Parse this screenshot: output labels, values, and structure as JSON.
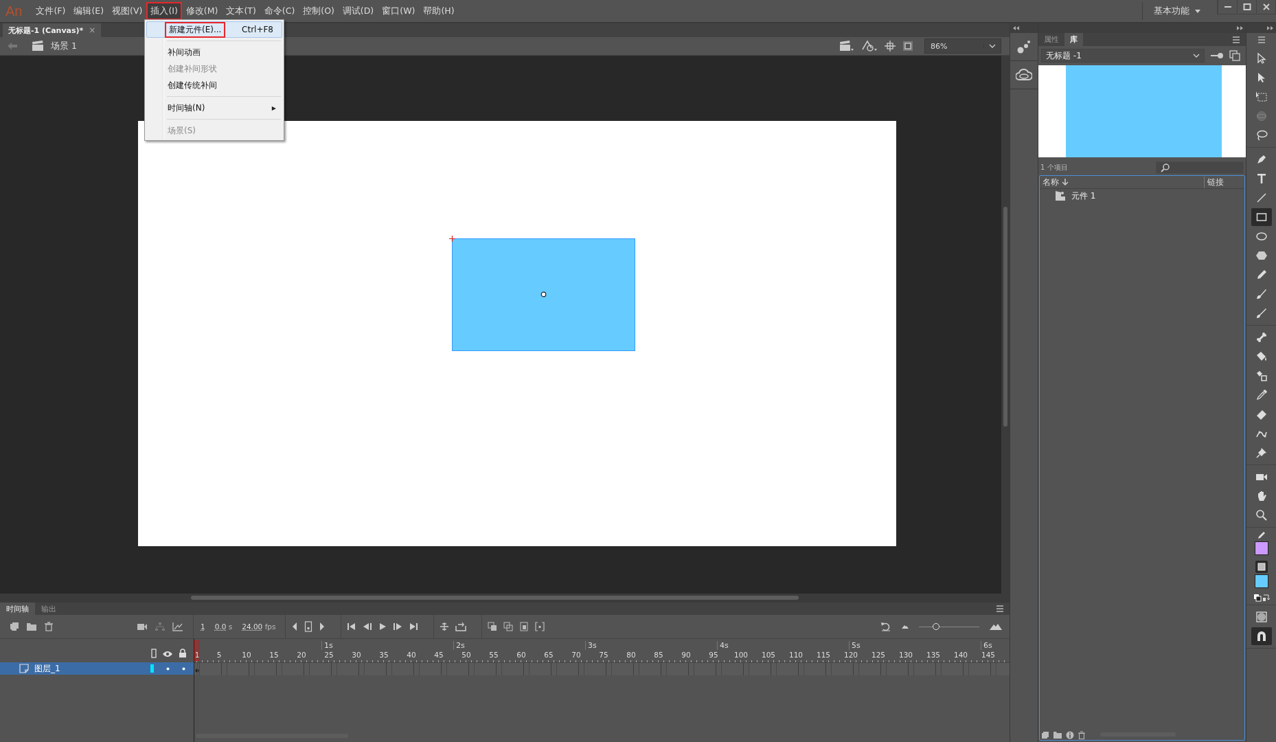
{
  "app": {
    "logo": "An"
  },
  "menu_bar": [
    {
      "label": "文件(F)",
      "selected": false,
      "highlighted": false
    },
    {
      "label": "编辑(E)",
      "selected": false,
      "highlighted": false
    },
    {
      "label": "视图(V)",
      "selected": false,
      "highlighted": false
    },
    {
      "label": "插入(I)",
      "selected": true,
      "highlighted": true
    },
    {
      "label": "修改(M)",
      "selected": false,
      "highlighted": false
    },
    {
      "label": "文本(T)",
      "selected": false,
      "highlighted": false
    },
    {
      "label": "命令(C)",
      "selected": false,
      "highlighted": false
    },
    {
      "label": "控制(O)",
      "selected": false,
      "highlighted": false
    },
    {
      "label": "调试(D)",
      "selected": false,
      "highlighted": false
    },
    {
      "label": "窗口(W)",
      "selected": false,
      "highlighted": false
    },
    {
      "label": "帮助(H)",
      "selected": false,
      "highlighted": false
    }
  ],
  "workspace": {
    "label": "基本功能"
  },
  "document_tabs": [
    {
      "title": "无标题-1 (Canvas)*",
      "close": "×",
      "selected": true
    }
  ],
  "edit_bar": {
    "scene": "场景 1",
    "zoom": "86%"
  },
  "insert_menu": {
    "items": [
      {
        "kind": "item",
        "label": "新建元件(E)...",
        "shortcut": "Ctrl+F8",
        "selected": true,
        "disabled": false,
        "highlighted": true
      },
      {
        "kind": "separator"
      },
      {
        "kind": "item",
        "label": "补间动画",
        "selected": false,
        "disabled": false,
        "highlighted": false
      },
      {
        "kind": "item",
        "label": "创建补间形状",
        "selected": false,
        "disabled": true,
        "highlighted": false
      },
      {
        "kind": "item",
        "label": "创建传统补间",
        "selected": false,
        "disabled": false,
        "highlighted": false
      },
      {
        "kind": "separator"
      },
      {
        "kind": "submenu",
        "label": "时间轴(N)",
        "arrow": "▶",
        "selected": false,
        "disabled": false,
        "highlighted": false
      },
      {
        "kind": "separator"
      },
      {
        "kind": "item",
        "label": "场景(S)",
        "selected": false,
        "disabled": true,
        "highlighted": false
      }
    ]
  },
  "timeline": {
    "tabs": [
      {
        "label": "时间轴",
        "selected": true
      },
      {
        "label": "输出",
        "selected": false
      }
    ],
    "frame": "1",
    "time": "0.0",
    "time_unit": "s",
    "fps": "24.00",
    "fps_unit": "fps",
    "seconds": [
      "1s",
      "2s",
      "3s",
      "4s",
      "5s",
      "6s"
    ],
    "frame_numbers": [
      "1",
      "5",
      "10",
      "15",
      "20",
      "25",
      "30",
      "35",
      "40",
      "45",
      "50",
      "55",
      "60",
      "65",
      "70",
      "75",
      "80",
      "85",
      "90",
      "95",
      "100",
      "105",
      "110",
      "115",
      "120",
      "125",
      "130",
      "135",
      "140",
      "145"
    ],
    "frame_size": {
      "level": 0.28
    },
    "layers": [
      {
        "name": "图层_1",
        "color": "#00e5ff",
        "selected": true
      }
    ]
  },
  "library": {
    "tabs": [
      {
        "label": "属性",
        "selected": false
      },
      {
        "label": "库",
        "selected": true
      }
    ],
    "document": "无标题 -1",
    "count": "1 个项目",
    "columns": [
      "名称",
      "链接"
    ],
    "items": [
      {
        "name": "元件 1"
      }
    ]
  },
  "tool_groups": [
    {
      "tools": [
        {
          "kind": "selection",
          "selected": false
        },
        {
          "kind": "subselection",
          "selected": false
        },
        {
          "kind": "free-transform",
          "selected": false
        },
        {
          "kind": "rotation",
          "selected": false
        },
        {
          "kind": "lasso",
          "selected": false
        }
      ]
    },
    {
      "tools": [
        {
          "kind": "pen",
          "selected": false
        },
        {
          "kind": "text",
          "selected": false
        },
        {
          "kind": "line",
          "selected": false
        },
        {
          "kind": "rectangle",
          "selected": true
        },
        {
          "kind": "oval",
          "selected": false
        },
        {
          "kind": "polystar",
          "selected": false
        },
        {
          "kind": "pencil",
          "selected": false
        },
        {
          "kind": "paint-brush",
          "selected": false
        },
        {
          "kind": "brush",
          "selected": false
        }
      ]
    },
    {
      "tools": [
        {
          "kind": "bone",
          "selected": false
        },
        {
          "kind": "paint-bucket",
          "selected": false
        },
        {
          "kind": "ink-bottle",
          "selected": false
        },
        {
          "kind": "eyedropper",
          "selected": false
        },
        {
          "kind": "eraser",
          "selected": false
        },
        {
          "kind": "width",
          "selected": false
        },
        {
          "kind": "pin",
          "selected": false
        }
      ]
    },
    {
      "tools": [
        {
          "kind": "camera",
          "selected": false
        },
        {
          "kind": "hand",
          "selected": false
        },
        {
          "kind": "zoom",
          "selected": false
        }
      ]
    }
  ],
  "swatches": [
    {
      "kind": "stroke",
      "color": "#cc99ff"
    },
    {
      "kind": "fill",
      "color": "#66ccff"
    }
  ]
}
